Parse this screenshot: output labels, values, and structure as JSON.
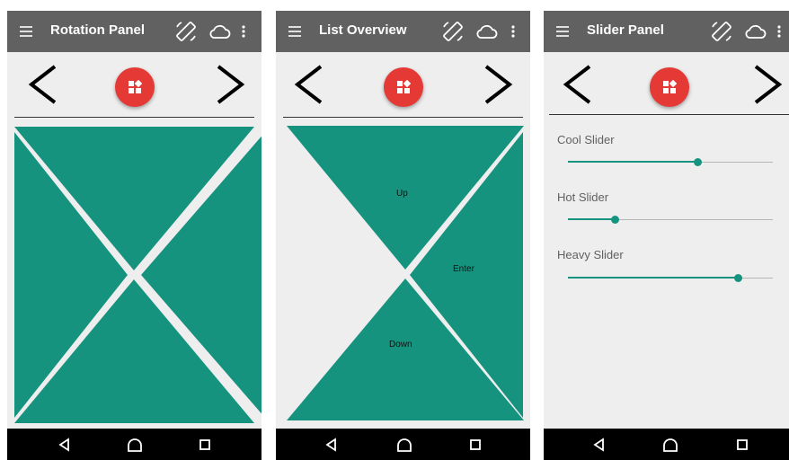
{
  "colors": {
    "appbar": "#616161",
    "accent": "#16937f",
    "fab": "#e53935",
    "background": "#eeeeee",
    "navbar": "#000000"
  },
  "icons": {
    "menu": "hamburger-menu-icon",
    "rotate": "screen-rotation-icon",
    "cloud": "cloud-outline-icon",
    "overflow": "more-vert-icon",
    "prev": "chevron-left-icon",
    "next": "chevron-right-icon",
    "fab": "dashboard-icon",
    "back": "triangle-back-icon",
    "home": "circle-home-icon",
    "recents": "square-recents-icon"
  },
  "screens": {
    "rotation": {
      "title": "Rotation Panel"
    },
    "list": {
      "title": "List Overview",
      "up": "Up",
      "enter": "Enter",
      "down": "Down"
    },
    "slider": {
      "title": "Slider Panel",
      "sliders": [
        {
          "label": "Cool Slider",
          "value": 0.63
        },
        {
          "label": "Hot Slider",
          "value": 0.23
        },
        {
          "label": "Heavy Slider",
          "value": 0.83
        }
      ]
    }
  }
}
